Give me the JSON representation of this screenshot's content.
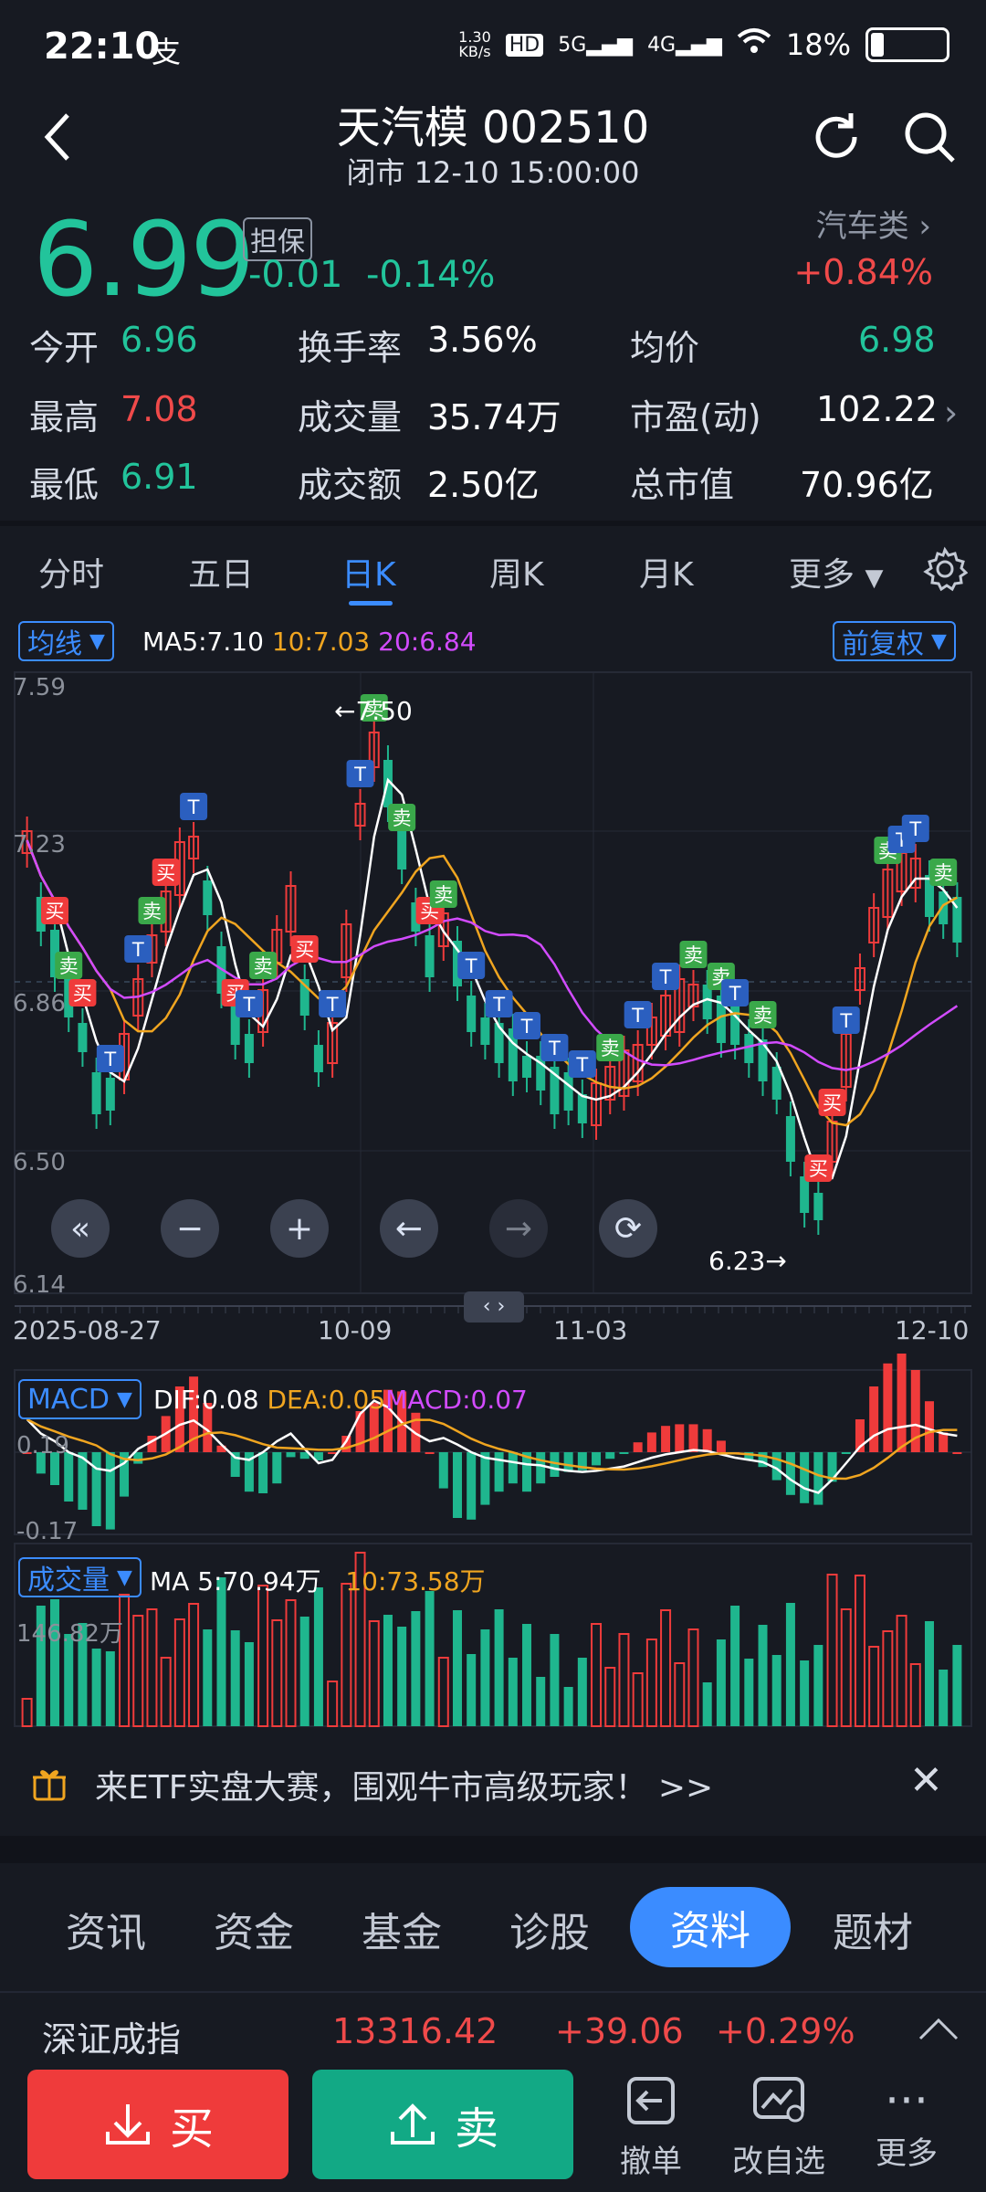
{
  "status_bar": {
    "time": "22:10",
    "pay_glyph": "支",
    "net_speed": "1.30\nKB/s",
    "hd": "HD",
    "signal1": "5G",
    "signal2": "4G",
    "battery": "18%",
    "battery_level": 0.18
  },
  "header": {
    "title": "天汽模 002510",
    "subtitle": "闭市 12-10 15:00:00"
  },
  "quote": {
    "price": "6.99",
    "tag": "担保",
    "change": "-0.01",
    "change_pct": "-0.14%",
    "sector_name": "汽车类",
    "sector_change": "+0.84%"
  },
  "stats": {
    "open_label": "今开",
    "open": "6.96",
    "high_label": "最高",
    "high": "7.08",
    "low_label": "最低",
    "low": "6.91",
    "turnover_label": "换手率",
    "turnover": "3.56%",
    "volume_label": "成交量",
    "volume": "35.74万",
    "amount_label": "成交额",
    "amount": "2.50亿",
    "avg_label": "均价",
    "avg": "6.98",
    "pe_label": "市盈(动)",
    "pe": "102.22",
    "mcap_label": "总市值",
    "mcap": "70.96亿"
  },
  "chart_tabs": [
    "分时",
    "五日",
    "日K",
    "周K",
    "月K"
  ],
  "chart_more": "更多",
  "kline": {
    "ma_select": "均线",
    "ma5": "MA5:7.10",
    "ma10": "10:7.03",
    "ma20": "20:6.84",
    "adjust": "前复权",
    "y_labels": [
      "7.59",
      "7.23",
      "6.86",
      "6.50",
      "6.14"
    ],
    "high_mark": "7.50",
    "low_mark": "6.23",
    "x_labels": [
      "2025-08-27",
      "10-09",
      "11-03",
      "12-10"
    ],
    "buy_label": "买",
    "sell_label": "卖",
    "t_label": "T",
    "colors": {
      "up": "#ef3b3b",
      "down": "#1fb68e",
      "ma5": "#ffffff",
      "ma10": "#f0a520",
      "ma20": "#d24bff"
    }
  },
  "macd": {
    "select": "MACD",
    "dif": "DIF:0.08",
    "dea": "DEA:0.05",
    "macd": "MACD:0.07",
    "y_top": "0.19",
    "y_bot": "-0.17"
  },
  "vol": {
    "select": "成交量",
    "ma5": "MA 5:70.94万",
    "ma10": "10:73.58万",
    "y_top": "146.82万"
  },
  "banner": {
    "text": "来ETF实盘大赛，围观牛市高级玩家！ >>"
  },
  "bottom_tabs": [
    "资讯",
    "资金",
    "基金",
    "诊股",
    "资料",
    "题材"
  ],
  "index": {
    "name": "深证成指",
    "value": "13316.42",
    "change": "+39.06",
    "pct": "+0.29%"
  },
  "actions": {
    "buy": "买",
    "sell": "卖",
    "cancel": "撤单",
    "watch": "改自选",
    "more": "更多"
  },
  "chart_data": {
    "type": "candlestick",
    "title": "",
    "ylim": [
      6.14,
      7.59
    ],
    "x_start": "2025-08-27",
    "x_end": "2025-12-10",
    "last_close": 6.99,
    "ma5": 7.1,
    "ma10": 7.03,
    "ma20": 6.84,
    "period_high": 7.5,
    "period_low": 6.23
  }
}
